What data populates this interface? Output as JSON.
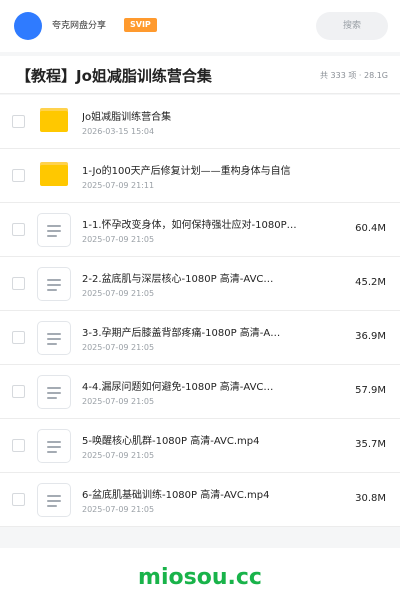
{
  "header": {
    "share_name": "夸克网盘分享",
    "badge": "SVIP",
    "search_placeholder": "搜索",
    "avatar_color": "#2f7bff"
  },
  "folder": {
    "title": "【教程】Jo姐减脂训练营合集",
    "meta": "共 333 项 · 28.1G"
  },
  "items": [
    {
      "type": "folder",
      "icon": "folder-icon",
      "name": "Jo姐减脂训练营合集",
      "date": "2026-03-15 15:04",
      "size": ""
    },
    {
      "type": "folder",
      "icon": "folder-icon",
      "name": "1-Jo的100天产后修复计划——重构身体与自信",
      "date": "2025-07-09 21:11",
      "size": ""
    },
    {
      "type": "file",
      "icon": "document-icon",
      "name": "1-1.怀孕改变身体，如何保持强壮应对-1080P…",
      "date": "2025-07-09 21:05",
      "size": "60.4M"
    },
    {
      "type": "file",
      "icon": "document-icon",
      "name": "2-2.盆底肌与深层核心-1080P 高清-AVC…",
      "date": "2025-07-09 21:05",
      "size": "45.2M"
    },
    {
      "type": "file",
      "icon": "document-icon",
      "name": "3-3.孕期产后膝盖背部疼痛-1080P 高清-A…",
      "date": "2025-07-09 21:05",
      "size": "36.9M"
    },
    {
      "type": "file",
      "icon": "document-icon",
      "name": "4-4.漏尿问题如何避免-1080P 高清-AVC…",
      "date": "2025-07-09 21:05",
      "size": "57.9M"
    },
    {
      "type": "file",
      "icon": "document-icon",
      "name": "5-唤醒核心肌群-1080P 高清-AVC.mp4",
      "date": "2025-07-09 21:05",
      "size": "35.7M"
    },
    {
      "type": "file",
      "icon": "document-icon",
      "name": "6-盆底肌基础训练-1080P 高清-AVC.mp4",
      "date": "2025-07-09 21:05",
      "size": "30.8M"
    }
  ],
  "watermark": "miosou.cc",
  "colors": {
    "badge": "#ff9a2e",
    "folder": "#ffc800",
    "watermark": "#19b34a"
  }
}
